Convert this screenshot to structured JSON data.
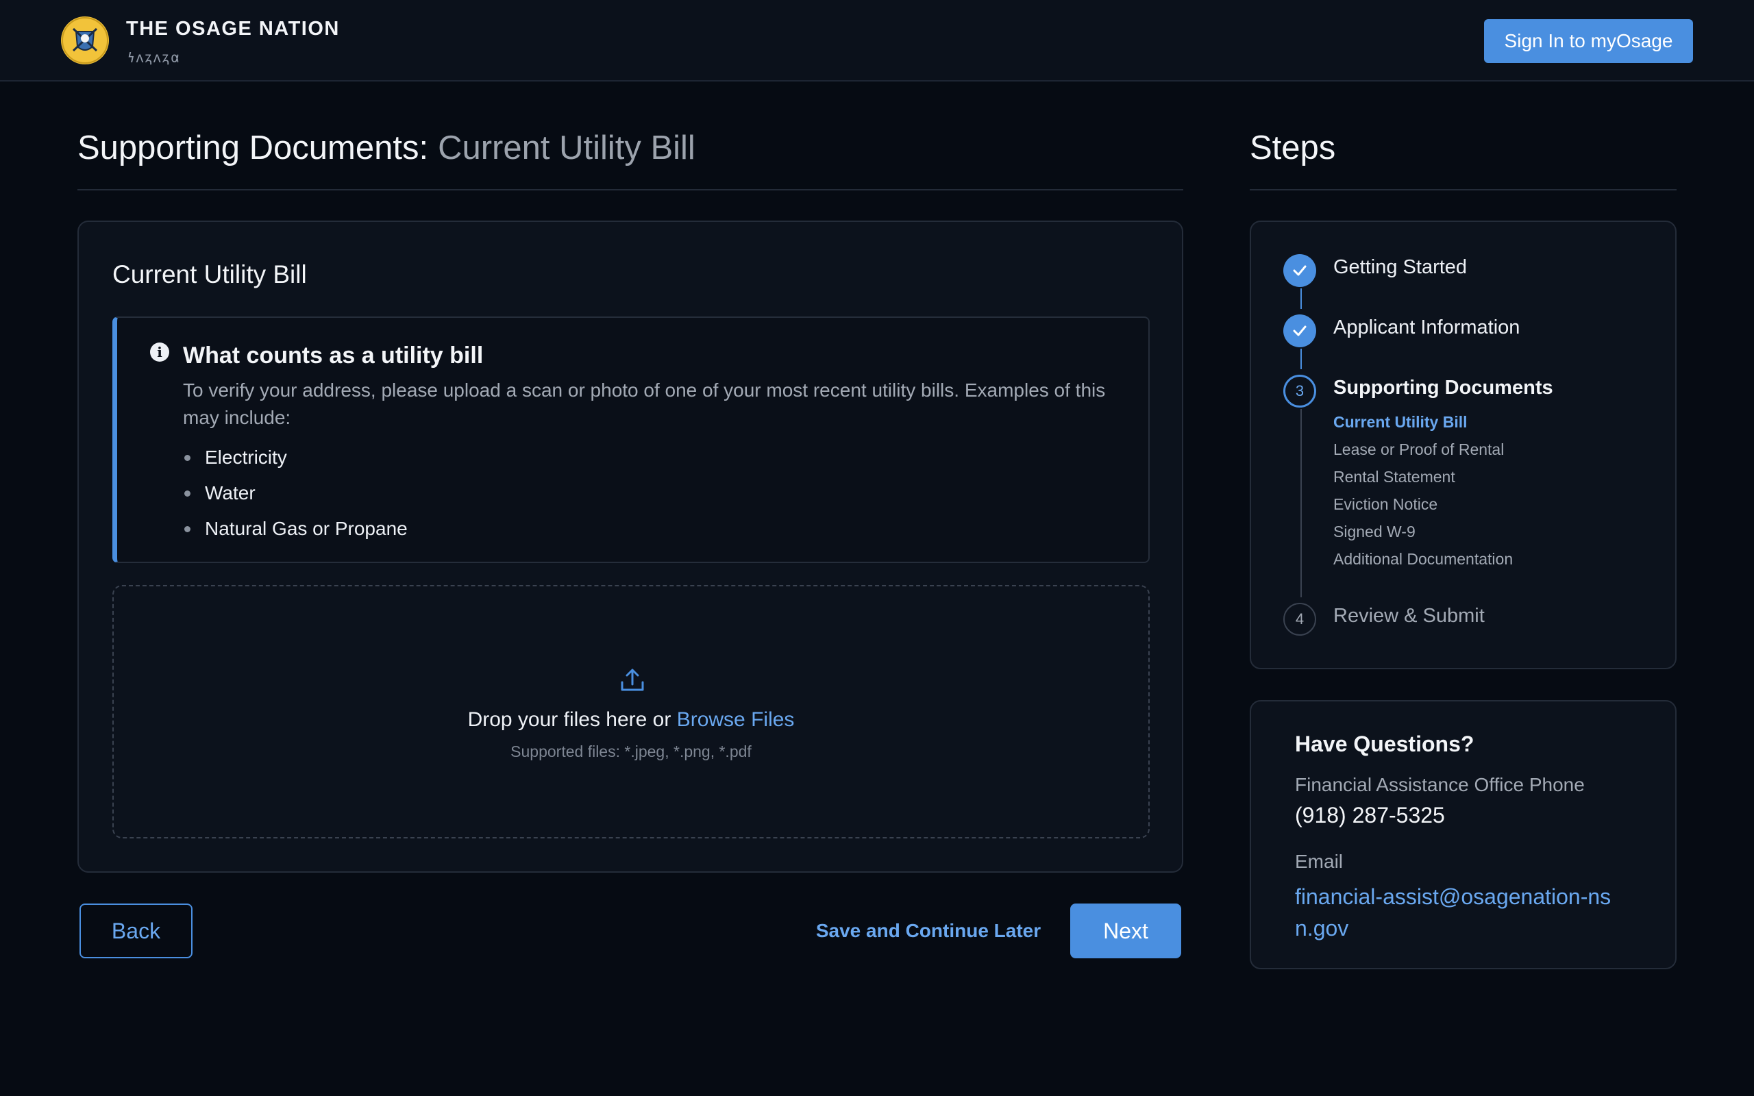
{
  "header": {
    "brand_title": "THE OSAGE NATION",
    "brand_subtitle": "𐓏𐓘𐓻𐓘𐓻𐓟",
    "signin_label": "Sign In to myOsage"
  },
  "page": {
    "title_prefix": "Supporting Documents:",
    "title_suffix": "Current Utility Bill"
  },
  "card": {
    "title": "Current Utility Bill",
    "info_title": "What counts as a utility bill",
    "info_body": "To verify your address, please upload a scan or photo of one of your most recent utility bills. Examples of this may include:",
    "info_items": [
      "Electricity",
      "Water",
      "Natural Gas or Propane"
    ],
    "drop_text": "Drop your files here or",
    "browse_label": "Browse Files",
    "supported": "Supported files: *.jpeg, *.png, *.pdf"
  },
  "actions": {
    "back": "Back",
    "save": "Save and Continue Later",
    "next": "Next"
  },
  "steps": {
    "title": "Steps",
    "items": [
      {
        "label": "Getting Started",
        "status": "done"
      },
      {
        "label": "Applicant Information",
        "status": "done"
      },
      {
        "label": "Supporting Documents",
        "status": "active",
        "number": "3"
      },
      {
        "label": "Review & Submit",
        "status": "pending",
        "number": "4"
      }
    ],
    "sub_steps": [
      "Current Utility Bill",
      "Lease or Proof of Rental",
      "Rental Statement",
      "Eviction Notice",
      "Signed W-9",
      "Additional Documentation"
    ]
  },
  "questions": {
    "title": "Have Questions?",
    "phone_label": "Financial Assistance Office Phone",
    "phone": "(918) 287-5325",
    "email_label": "Email",
    "email": "financial-assist@osagenation-nsn.gov"
  },
  "colors": {
    "accent": "#4a8fe0",
    "background": "#060b13",
    "logo": "#f2c33a"
  }
}
